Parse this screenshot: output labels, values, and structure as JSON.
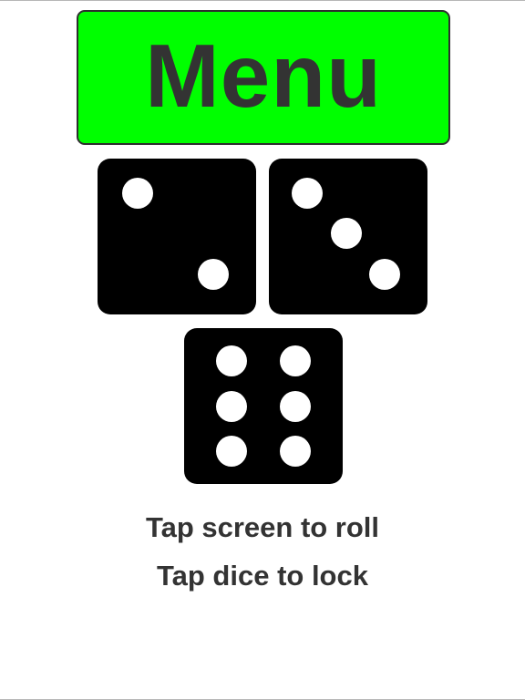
{
  "menu": {
    "label": "Menu",
    "background_color": "#00ff00",
    "text_color": "#333333"
  },
  "dice": [
    {
      "value": 2,
      "locked": false
    },
    {
      "value": 3,
      "locked": false
    },
    {
      "value": 6,
      "locked": false
    }
  ],
  "dice_style": {
    "face_color": "#000000",
    "pip_color": "#ffffff"
  },
  "instructions": {
    "line1": "Tap screen to roll",
    "line2": "Tap dice to lock",
    "text_color": "#333333"
  }
}
